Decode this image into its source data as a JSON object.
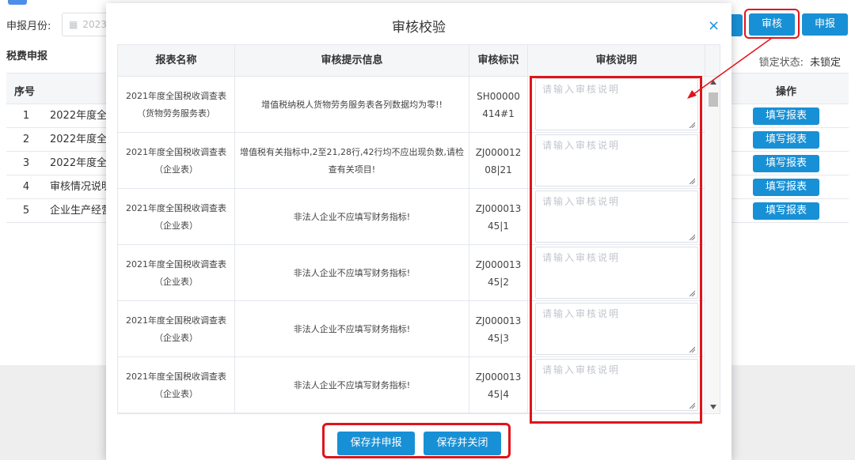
{
  "background": {
    "month_label": "申报月份:",
    "month_value": "2023",
    "section_title": "税费申报",
    "lock_label": "锁定状态:",
    "lock_value": "未锁定",
    "review_button": "审核",
    "submit_button": "申报",
    "table": {
      "col_no": "序号",
      "col_op": "操作",
      "rows": [
        {
          "no": "1",
          "name": "2022年度全",
          "op": "填写报表"
        },
        {
          "no": "2",
          "name": "2022年度全",
          "op": "填写报表"
        },
        {
          "no": "3",
          "name": "2022年度全",
          "op": "填写报表"
        },
        {
          "no": "4",
          "name": "审核情况说明",
          "op": "填写报表"
        },
        {
          "no": "5",
          "name": "企业生产经营",
          "op": "填写报表"
        }
      ]
    }
  },
  "modal": {
    "title": "审核校验",
    "close_icon": "close-icon",
    "columns": [
      "报表名称",
      "审核提示信息",
      "审核标识",
      "审核说明"
    ],
    "rows": [
      {
        "name": "2021年度全国税收调查表（货物劳务服务表）",
        "message": "增值税纳税人货物劳务服务表各列数据均为零!!",
        "code": "SH00000414#1",
        "placeholder": "请输入审核说明"
      },
      {
        "name": "2021年度全国税收调查表（企业表）",
        "message": "增值税有关指标中,2至21,28行,42行均不应出现负数,请检查有关项目!",
        "code": "ZJ00001208|21",
        "placeholder": "请输入审核说明"
      },
      {
        "name": "2021年度全国税收调查表（企业表）",
        "message": "非法人企业不应填写财务指标!",
        "code": "ZJ00001345|1",
        "placeholder": "请输入审核说明"
      },
      {
        "name": "2021年度全国税收调查表（企业表）",
        "message": "非法人企业不应填写财务指标!",
        "code": "ZJ00001345|2",
        "placeholder": "请输入审核说明"
      },
      {
        "name": "2021年度全国税收调查表（企业表）",
        "message": "非法人企业不应填写财务指标!",
        "code": "ZJ00001345|3",
        "placeholder": "请输入审核说明"
      },
      {
        "name": "2021年度全国税收调查表（企业表）",
        "message": "非法人企业不应填写财务指标!",
        "code": "ZJ00001345|4",
        "placeholder": "请输入审核说明"
      }
    ],
    "save_submit": "保存并申报",
    "save_close": "保存并关闭"
  },
  "colors": {
    "accent": "#1890d5",
    "highlight": "#e0141b"
  }
}
